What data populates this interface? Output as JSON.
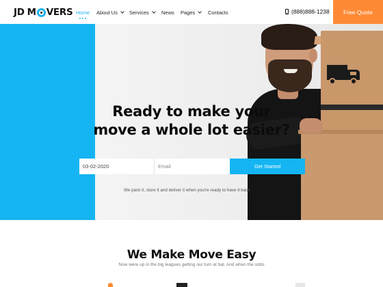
{
  "header": {
    "logo": {
      "part1": "JD",
      "part2": "M",
      "part3": "VERS"
    },
    "nav": [
      {
        "label": "Home",
        "active": true,
        "has_dropdown": false
      },
      {
        "label": "About Us",
        "active": false,
        "has_dropdown": true
      },
      {
        "label": "Services",
        "active": false,
        "has_dropdown": true
      },
      {
        "label": "News",
        "active": false,
        "has_dropdown": false
      },
      {
        "label": "Pages",
        "active": false,
        "has_dropdown": true
      },
      {
        "label": "Contacts",
        "active": false,
        "has_dropdown": false
      }
    ],
    "phone": "(888)888-1238",
    "cta": "Free Quote"
  },
  "hero": {
    "title_line1": "Ready to make your",
    "title_line2": "move a whole lot easier?",
    "form": {
      "date_value": "03-02-2020",
      "email_placeholder": "Email",
      "submit_label": "Get Started"
    },
    "subtitle": "We pack it, store it and deliver it when you're ready to have it back"
  },
  "section": {
    "title": "We Make Move Easy",
    "subtitle": "Now were up in the big leagues getting our turn at bat. And when the odds"
  },
  "colors": {
    "accent_blue": "#14b5f2",
    "accent_orange": "#ff8a35"
  },
  "icons": {
    "phone": "phone-icon",
    "dropdown": "chevron-down-icon",
    "truck": "truck-icon"
  }
}
